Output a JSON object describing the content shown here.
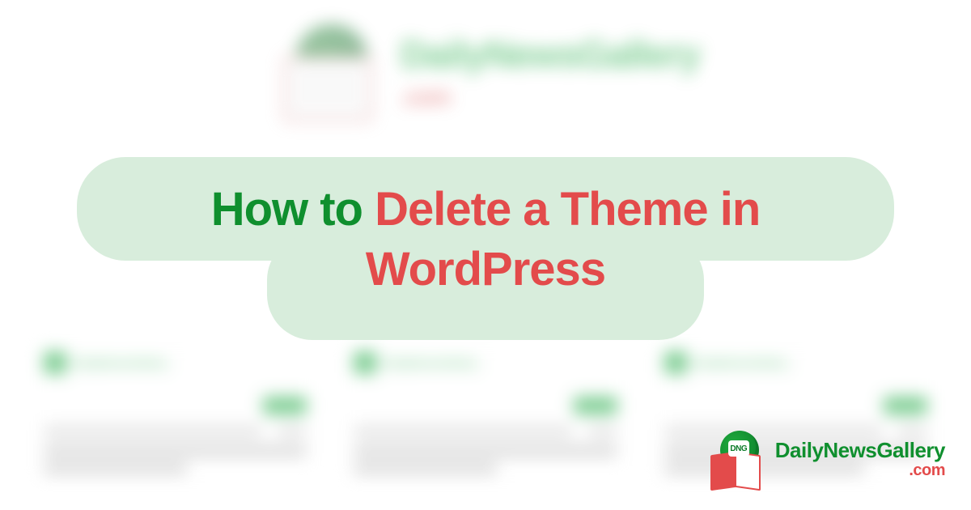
{
  "brand": {
    "name": "DailyNewsGallery",
    "domain": ".com",
    "badge": "DNG"
  },
  "title": {
    "part_green": "How to ",
    "part_red": "Delete a Theme in WordPress"
  },
  "colors": {
    "green": "#0f8f2e",
    "red": "#e34b4b",
    "pill": "#d8eddc"
  }
}
